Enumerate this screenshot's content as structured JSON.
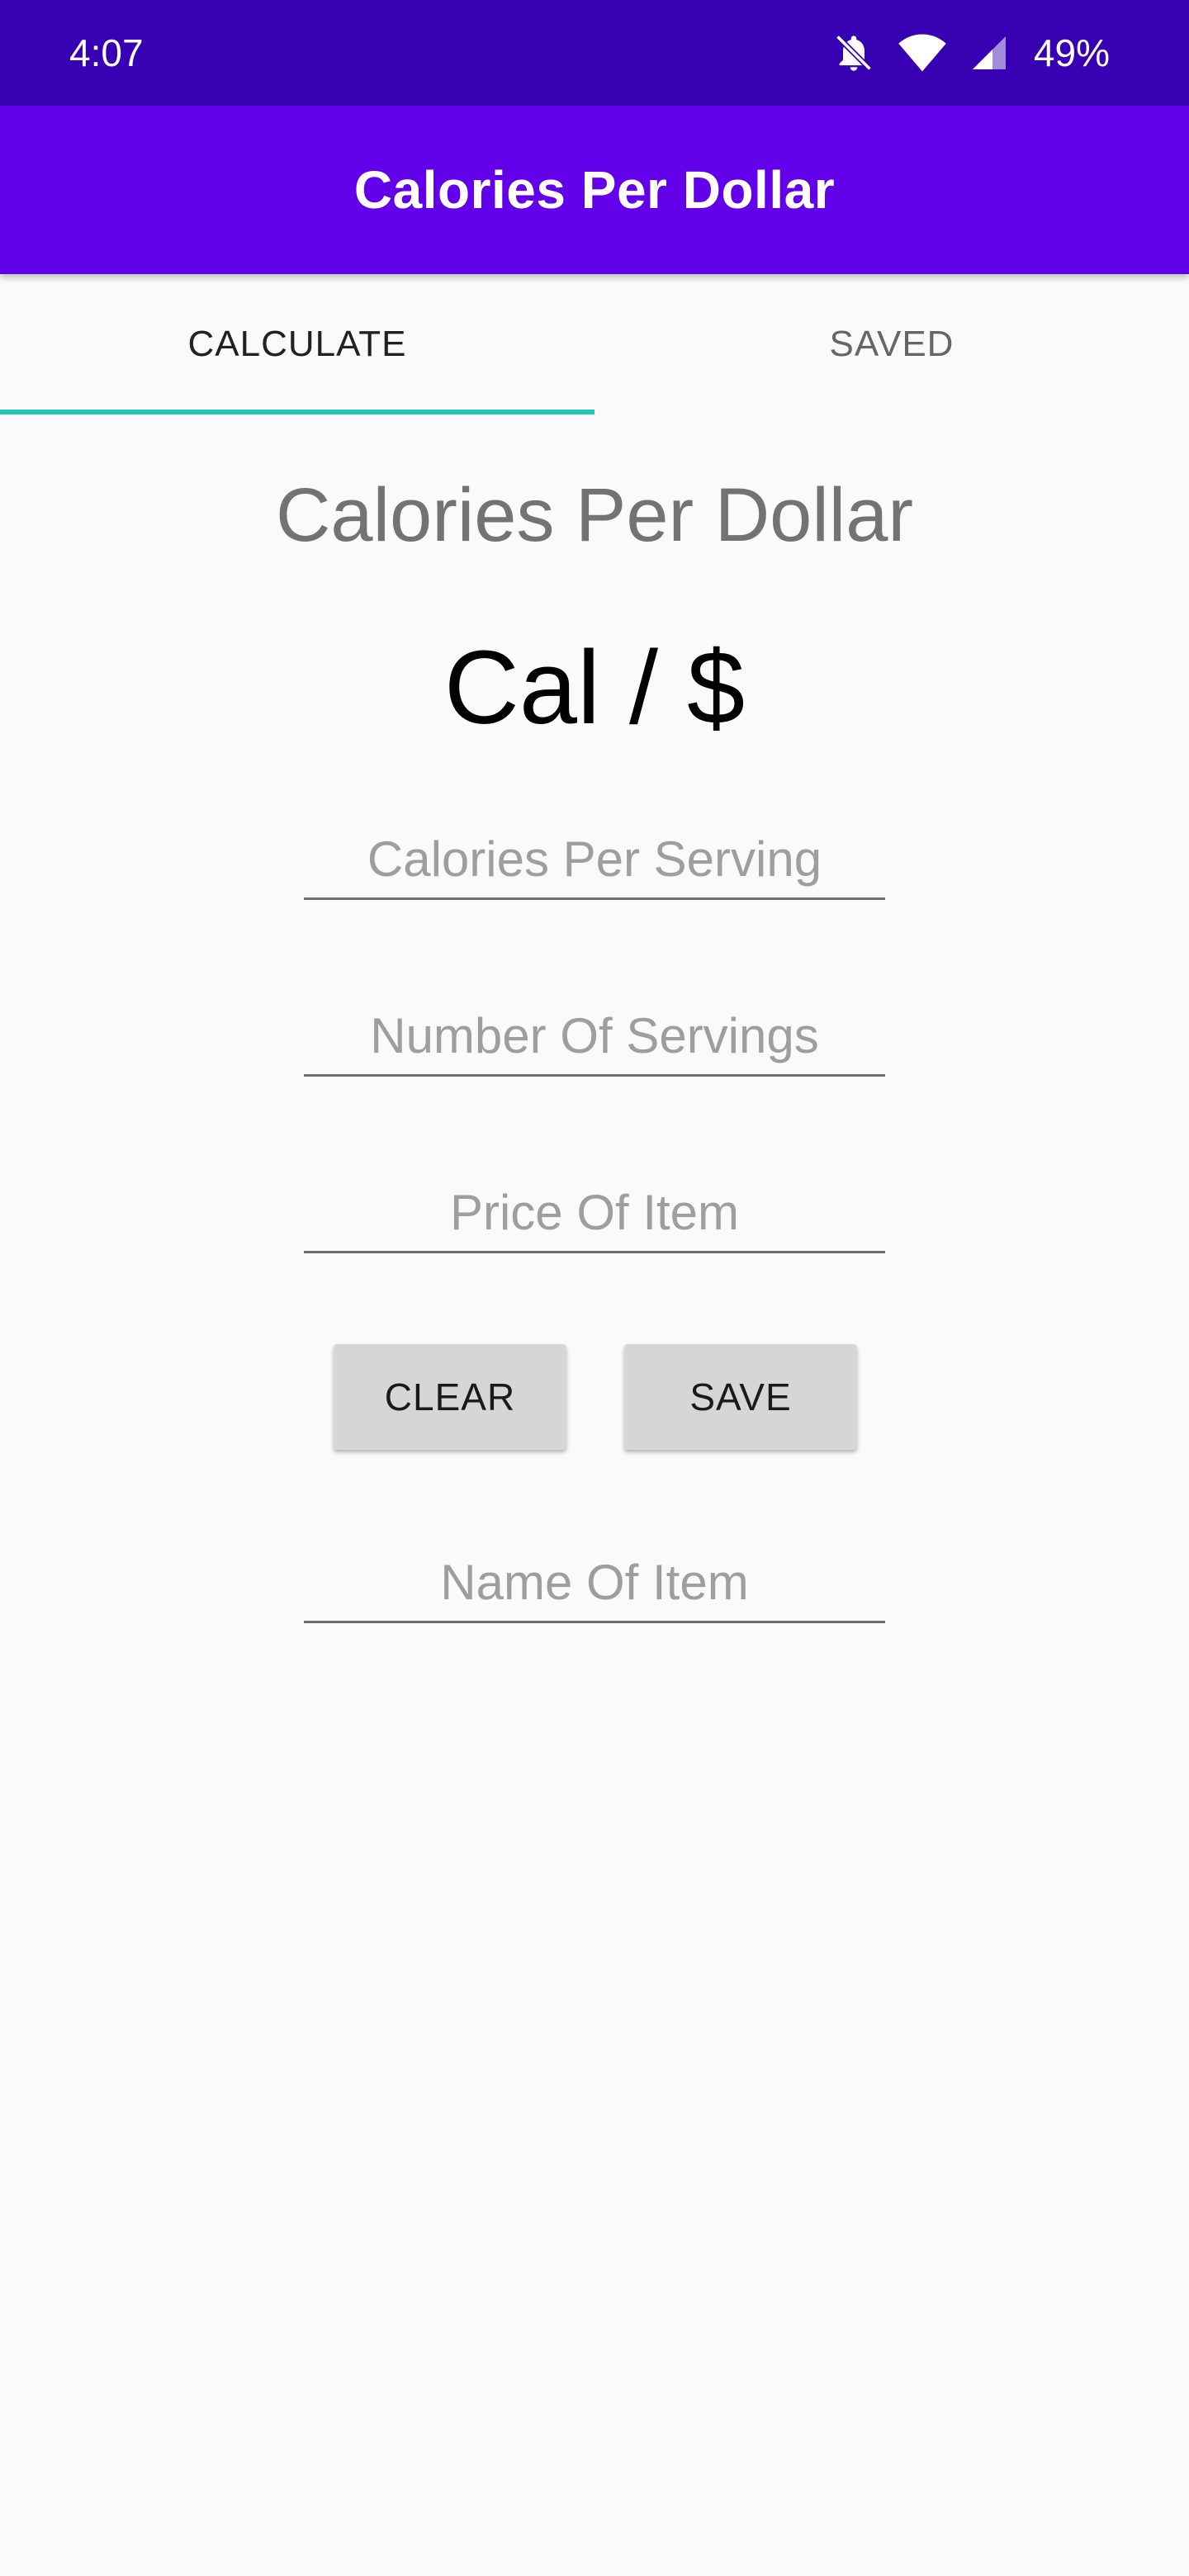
{
  "status_bar": {
    "time": "4:07",
    "battery": "49%",
    "icons": [
      "bell-off-icon",
      "wifi-icon",
      "cell-signal-icon"
    ]
  },
  "app_bar": {
    "title": "Calories Per Dollar",
    "color": "#6200ea"
  },
  "tabs": [
    {
      "label": "CALCULATE",
      "active": true
    },
    {
      "label": "SAVED",
      "active": false
    }
  ],
  "tab_indicator_color": "#26c6b5",
  "main": {
    "heading": "Calories Per Dollar",
    "result": "Cal / $",
    "fields": {
      "calories_per_serving": {
        "placeholder": "Calories Per Serving",
        "value": ""
      },
      "number_of_servings": {
        "placeholder": "Number Of Servings",
        "value": ""
      },
      "price_of_item": {
        "placeholder": "Price Of Item",
        "value": ""
      },
      "name_of_item": {
        "placeholder": "Name Of Item",
        "value": ""
      }
    },
    "buttons": {
      "clear": "CLEAR",
      "save": "SAVE"
    }
  }
}
